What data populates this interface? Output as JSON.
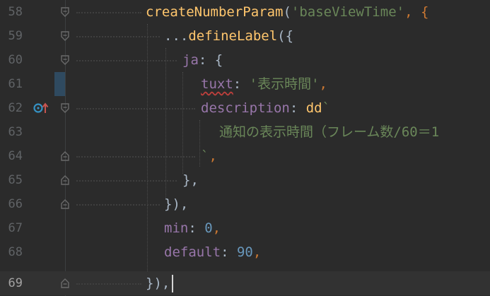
{
  "editor": {
    "colors": {
      "background": "#2b2b2b",
      "current_line": "#323232",
      "function": "#ffc66d",
      "string": "#6a8759",
      "property": "#9876aa",
      "number": "#6897bb",
      "punctuation": "#cc7832",
      "text": "#a9b7c6"
    },
    "current_line_number": "69",
    "lines": [
      {
        "num": "58",
        "tokens": [
          "createNumberParam",
          "(",
          "'baseViewTime'",
          ", {"
        ]
      },
      {
        "num": "59",
        "tokens": [
          "...",
          "defineLabel",
          "({"
        ]
      },
      {
        "num": "60",
        "tokens": [
          "ja",
          ": {"
        ]
      },
      {
        "num": "61",
        "tokens": [
          "tuxt",
          ": ",
          "'表示時間'",
          ","
        ]
      },
      {
        "num": "62",
        "tokens": [
          "description",
          ": ",
          "dd",
          "`"
        ]
      },
      {
        "num": "63",
        "tokens": [
          "通知の表示時間（フレーム数/60＝1"
        ]
      },
      {
        "num": "64",
        "tokens": [
          "`",
          ","
        ]
      },
      {
        "num": "65",
        "tokens": [
          "},"
        ]
      },
      {
        "num": "66",
        "tokens": [
          "}),"
        ]
      },
      {
        "num": "67",
        "tokens": [
          "min",
          ": ",
          "0",
          ","
        ]
      },
      {
        "num": "68",
        "tokens": [
          "default",
          ": ",
          "90",
          ","
        ]
      },
      {
        "num": "69",
        "tokens": [
          "}),"
        ]
      }
    ],
    "gutter_icons": {
      "line_62": "implementation-override-icon"
    }
  }
}
